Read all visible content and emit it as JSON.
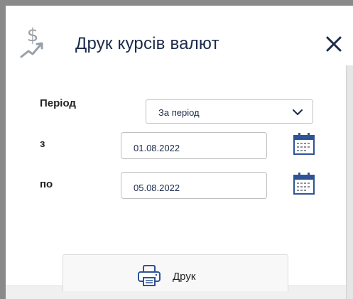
{
  "dialog": {
    "title": "Друк курсів валют",
    "icons": {
      "title": "dollar-chart-icon",
      "close": "close-icon"
    }
  },
  "form": {
    "period": {
      "label": "Період",
      "value": "За період",
      "icon": "chevron-down-icon"
    },
    "from": {
      "label": "з",
      "value": "01.08.2022",
      "icon": "calendar-icon"
    },
    "to": {
      "label": "по",
      "value": "05.08.2022",
      "icon": "calendar-icon"
    }
  },
  "actions": {
    "print": {
      "label": "Друк",
      "icon": "printer-icon"
    }
  },
  "colors": {
    "accent": "#1b2a4a",
    "icon_blue": "#2f5496",
    "gray_icon": "#9aa0a8"
  }
}
